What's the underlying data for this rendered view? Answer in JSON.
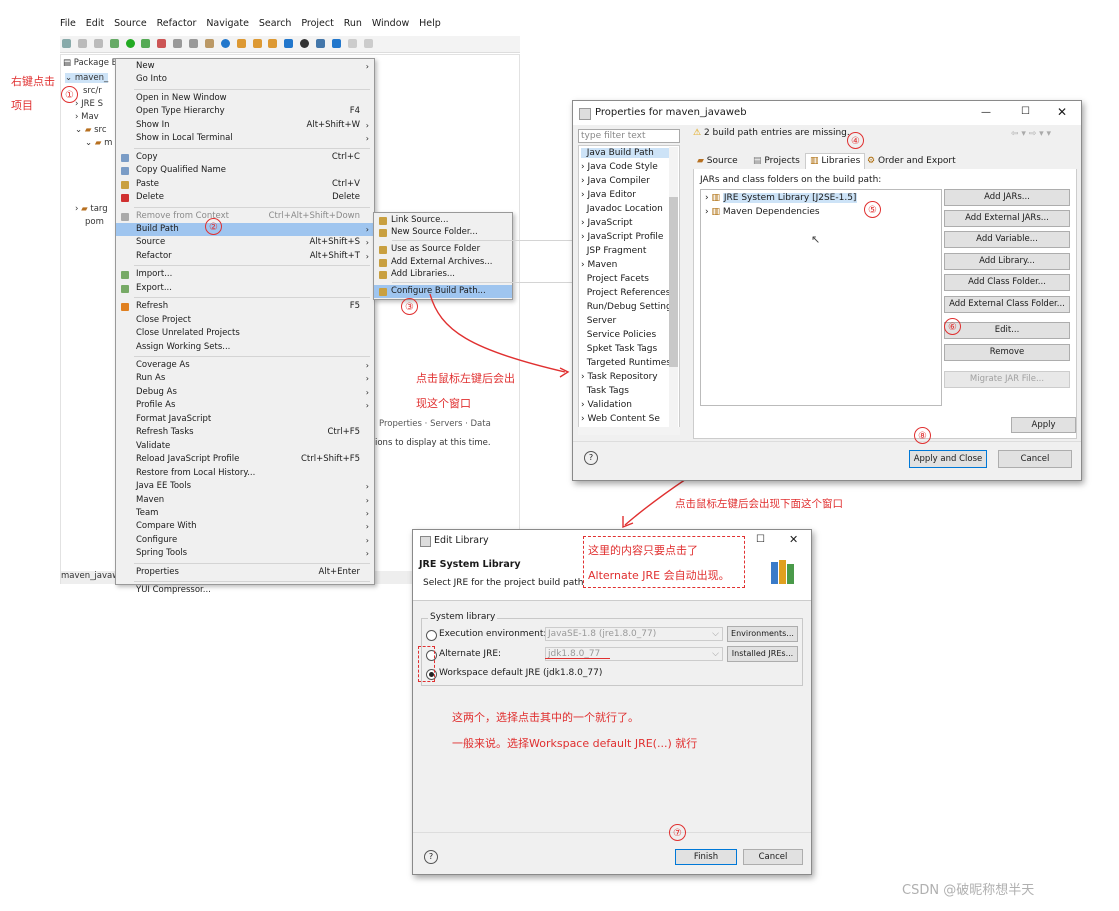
{
  "menubar": [
    "File",
    "Edit",
    "Source",
    "Refactor",
    "Navigate",
    "Search",
    "Project",
    "Run",
    "Window",
    "Help"
  ],
  "package_explorer": {
    "tab": "Package E",
    "items": [
      "maven_",
      "src/r",
      "JRE S",
      "Mav",
      "src",
      "m",
      "targ",
      "pom"
    ],
    "status": "maven_javaw"
  },
  "bg_tabs": [
    "Properties",
    "Servers",
    "Data"
  ],
  "bg_message": "ions to display at this time.",
  "context_menu": [
    {
      "label": "New",
      "arrow": true
    },
    {
      "label": "Go Into"
    },
    {
      "sep": true
    },
    {
      "label": "Open in New Window"
    },
    {
      "label": "Open Type Hierarchy",
      "shortcut": "F4"
    },
    {
      "label": "Show In",
      "shortcut": "Alt+Shift+W",
      "arrow": true
    },
    {
      "label": "Show in Local Terminal",
      "arrow": true
    },
    {
      "sep": true
    },
    {
      "label": "Copy",
      "shortcut": "Ctrl+C",
      "icon": "copy-icon"
    },
    {
      "label": "Copy Qualified Name",
      "icon": "copy-icon"
    },
    {
      "label": "Paste",
      "shortcut": "Ctrl+V",
      "icon": "paste-icon"
    },
    {
      "label": "Delete",
      "shortcut": "Delete",
      "icon": "delete-icon"
    },
    {
      "sep": true
    },
    {
      "label": "Remove from Context",
      "shortcut": "Ctrl+Alt+Shift+Down",
      "disabled": true,
      "icon": "remove-icon"
    },
    {
      "label": "Build Path",
      "arrow": true,
      "highlight": true
    },
    {
      "label": "Source",
      "shortcut": "Alt+Shift+S",
      "arrow": true
    },
    {
      "label": "Refactor",
      "shortcut": "Alt+Shift+T",
      "arrow": true
    },
    {
      "sep": true
    },
    {
      "label": "Import...",
      "icon": "import-icon"
    },
    {
      "label": "Export...",
      "icon": "export-icon"
    },
    {
      "sep": true
    },
    {
      "label": "Refresh",
      "shortcut": "F5",
      "icon": "refresh-icon"
    },
    {
      "label": "Close Project"
    },
    {
      "label": "Close Unrelated Projects"
    },
    {
      "label": "Assign Working Sets..."
    },
    {
      "sep": true
    },
    {
      "label": "Coverage As",
      "arrow": true
    },
    {
      "label": "Run As",
      "arrow": true
    },
    {
      "label": "Debug As",
      "arrow": true
    },
    {
      "label": "Profile As",
      "arrow": true
    },
    {
      "label": "Format JavaScript"
    },
    {
      "label": "Refresh Tasks",
      "shortcut": "Ctrl+F5"
    },
    {
      "label": "Validate"
    },
    {
      "label": "Reload JavaScript Profile",
      "shortcut": "Ctrl+Shift+F5"
    },
    {
      "label": "Restore from Local History..."
    },
    {
      "label": "Java EE Tools",
      "arrow": true
    },
    {
      "label": "Maven",
      "arrow": true
    },
    {
      "label": "Team",
      "arrow": true
    },
    {
      "label": "Compare With",
      "arrow": true
    },
    {
      "label": "Configure",
      "arrow": true
    },
    {
      "label": "Spring Tools",
      "arrow": true
    },
    {
      "sep": true
    },
    {
      "label": "Properties",
      "shortcut": "Alt+Enter"
    },
    {
      "sep": true
    },
    {
      "label": "YUI Compressor..."
    }
  ],
  "build_path_submenu": [
    {
      "label": "Link Source..."
    },
    {
      "label": "New Source Folder..."
    },
    {
      "sep": true
    },
    {
      "label": "Use as Source Folder"
    },
    {
      "label": "Add External Archives..."
    },
    {
      "label": "Add Libraries..."
    },
    {
      "sep": true
    },
    {
      "label": "Configure Build Path...",
      "highlight": true
    }
  ],
  "properties_window": {
    "title": "Properties for maven_javaweb",
    "filter_placeholder": "type filter text",
    "warning": "2 build path entries are missing.",
    "nav": [
      "Java Build Path",
      "Java Code Style",
      "Java Compiler",
      "Java Editor",
      "Javadoc Location",
      "JavaScript",
      "JavaScript Profile",
      "JSP Fragment",
      "Maven",
      "Project Facets",
      "Project References",
      "Run/Debug Settings",
      "Server",
      "Service Policies",
      "Spket Task Tags",
      "Targeted Runtimes",
      "Task Repository",
      "Task Tags",
      "Validation",
      "Web Content Se"
    ],
    "tabs": [
      "Source",
      "Projects",
      "Libraries",
      "Order and Export"
    ],
    "list_label": "JARs and class folders on the build path:",
    "entries": [
      "JRE System Library [J2SE-1.5]",
      "Maven Dependencies"
    ],
    "buttons": [
      "Add JARs...",
      "Add External JARs...",
      "Add Variable...",
      "Add Library...",
      "Add Class Folder...",
      "Add External Class Folder...",
      "Edit...",
      "Remove",
      "Migrate JAR File..."
    ],
    "apply": "Apply",
    "apply_close": "Apply and Close",
    "cancel": "Cancel"
  },
  "edit_library": {
    "title": "Edit Library",
    "heading": "JRE System Library",
    "desc": "Select JRE for the project build path.",
    "group": "System library",
    "options": [
      {
        "label": "Execution environment:",
        "value": "JavaSE-1.8 (jre1.8.0_77)",
        "button": "Environments..."
      },
      {
        "label": "Alternate JRE:",
        "value": "jdk1.8.0_77",
        "button": "Installed JREs..."
      },
      {
        "label": "Workspace default JRE (jdk1.8.0_77)",
        "selected": true
      }
    ],
    "finish": "Finish",
    "cancel": "Cancel"
  },
  "annotations": {
    "right_click": "右键点击",
    "project": "项目",
    "after_click": "点击鼠标左键后会出",
    "window_appears": "现这个窗口",
    "after_click_below": "点击鼠标左键后会出现下面这个窗口",
    "box_line1": "这里的内容只要点击了",
    "box_line2": "Alternate JRE 会自动出现。",
    "choose_one": "这两个，选择点击其中的一个就行了。",
    "generally": "一般来说。选择Workspace default JRE(...) 就行",
    "numbers": [
      "①",
      "②",
      "③",
      "④",
      "⑤",
      "⑥",
      "⑦",
      "⑧"
    ]
  },
  "watermark": "CSDN @破昵称想半天"
}
